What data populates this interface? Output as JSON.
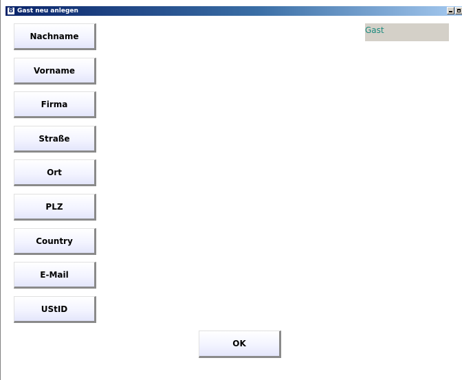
{
  "window": {
    "title": "Gast neu anlegen",
    "icon": "app-icon",
    "title_gradient": [
      "#0a246a",
      "#a6caf0"
    ]
  },
  "panel": {
    "label": "Gast",
    "label_color": "#1b8a7e",
    "background": "#d4d0c8"
  },
  "fields": [
    {
      "label": "Nachname"
    },
    {
      "label": "Vorname"
    },
    {
      "label": "Firma"
    },
    {
      "label": "Straße"
    },
    {
      "label": "Ort"
    },
    {
      "label": "PLZ"
    },
    {
      "label": "Country"
    },
    {
      "label": "E-Mail"
    },
    {
      "label": "UStID"
    }
  ],
  "actions": {
    "ok_label": "OK"
  }
}
